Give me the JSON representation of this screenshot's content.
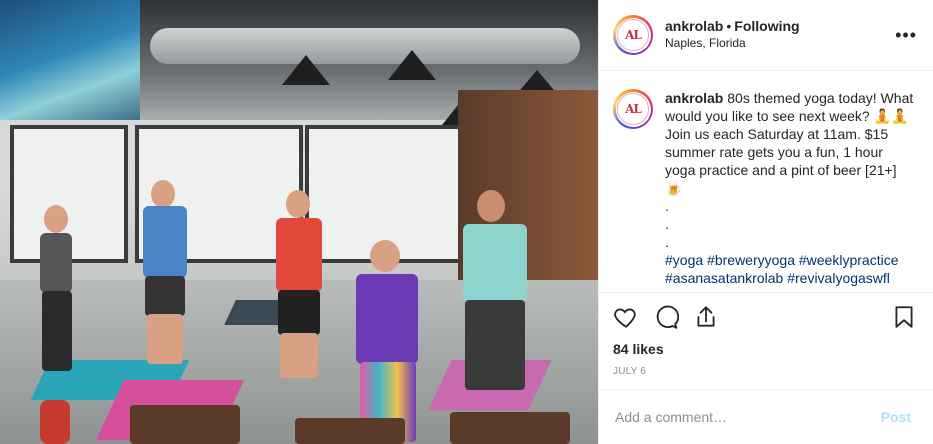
{
  "colors": {
    "link": "#003569",
    "muted": "#8e8e8e",
    "post_disabled": "#b2dffc",
    "logo": "#c8323f"
  },
  "header": {
    "username": "ankrolab",
    "separator": "•",
    "follow_state": "Following",
    "location": "Naples, Florida",
    "more_icon": "more-horizontal-icon"
  },
  "avatar": {
    "logo_text": "AL"
  },
  "caption": {
    "username": "ankrolab",
    "text": " 80s themed yoga today! What would you like to see next week? 🧘🧘 Join us each Saturday at 11am. $15 summer rate gets you a fun, 1 hour yoga practice and a pint of beer [21+] 🍺\n.\n.\n.",
    "hashtags": [
      "#yoga",
      "#breweryyoga",
      "#weeklypractice",
      "#asanasatankrolab",
      "#revivalyogaswfl"
    ]
  },
  "actions": {
    "like_icon": "heart-icon",
    "comment_icon": "comment-icon",
    "share_icon": "share-icon",
    "save_icon": "bookmark-icon"
  },
  "likes": "84 likes",
  "date": "JULY 6",
  "comment": {
    "placeholder": "Add a comment…",
    "post_label": "Post"
  }
}
